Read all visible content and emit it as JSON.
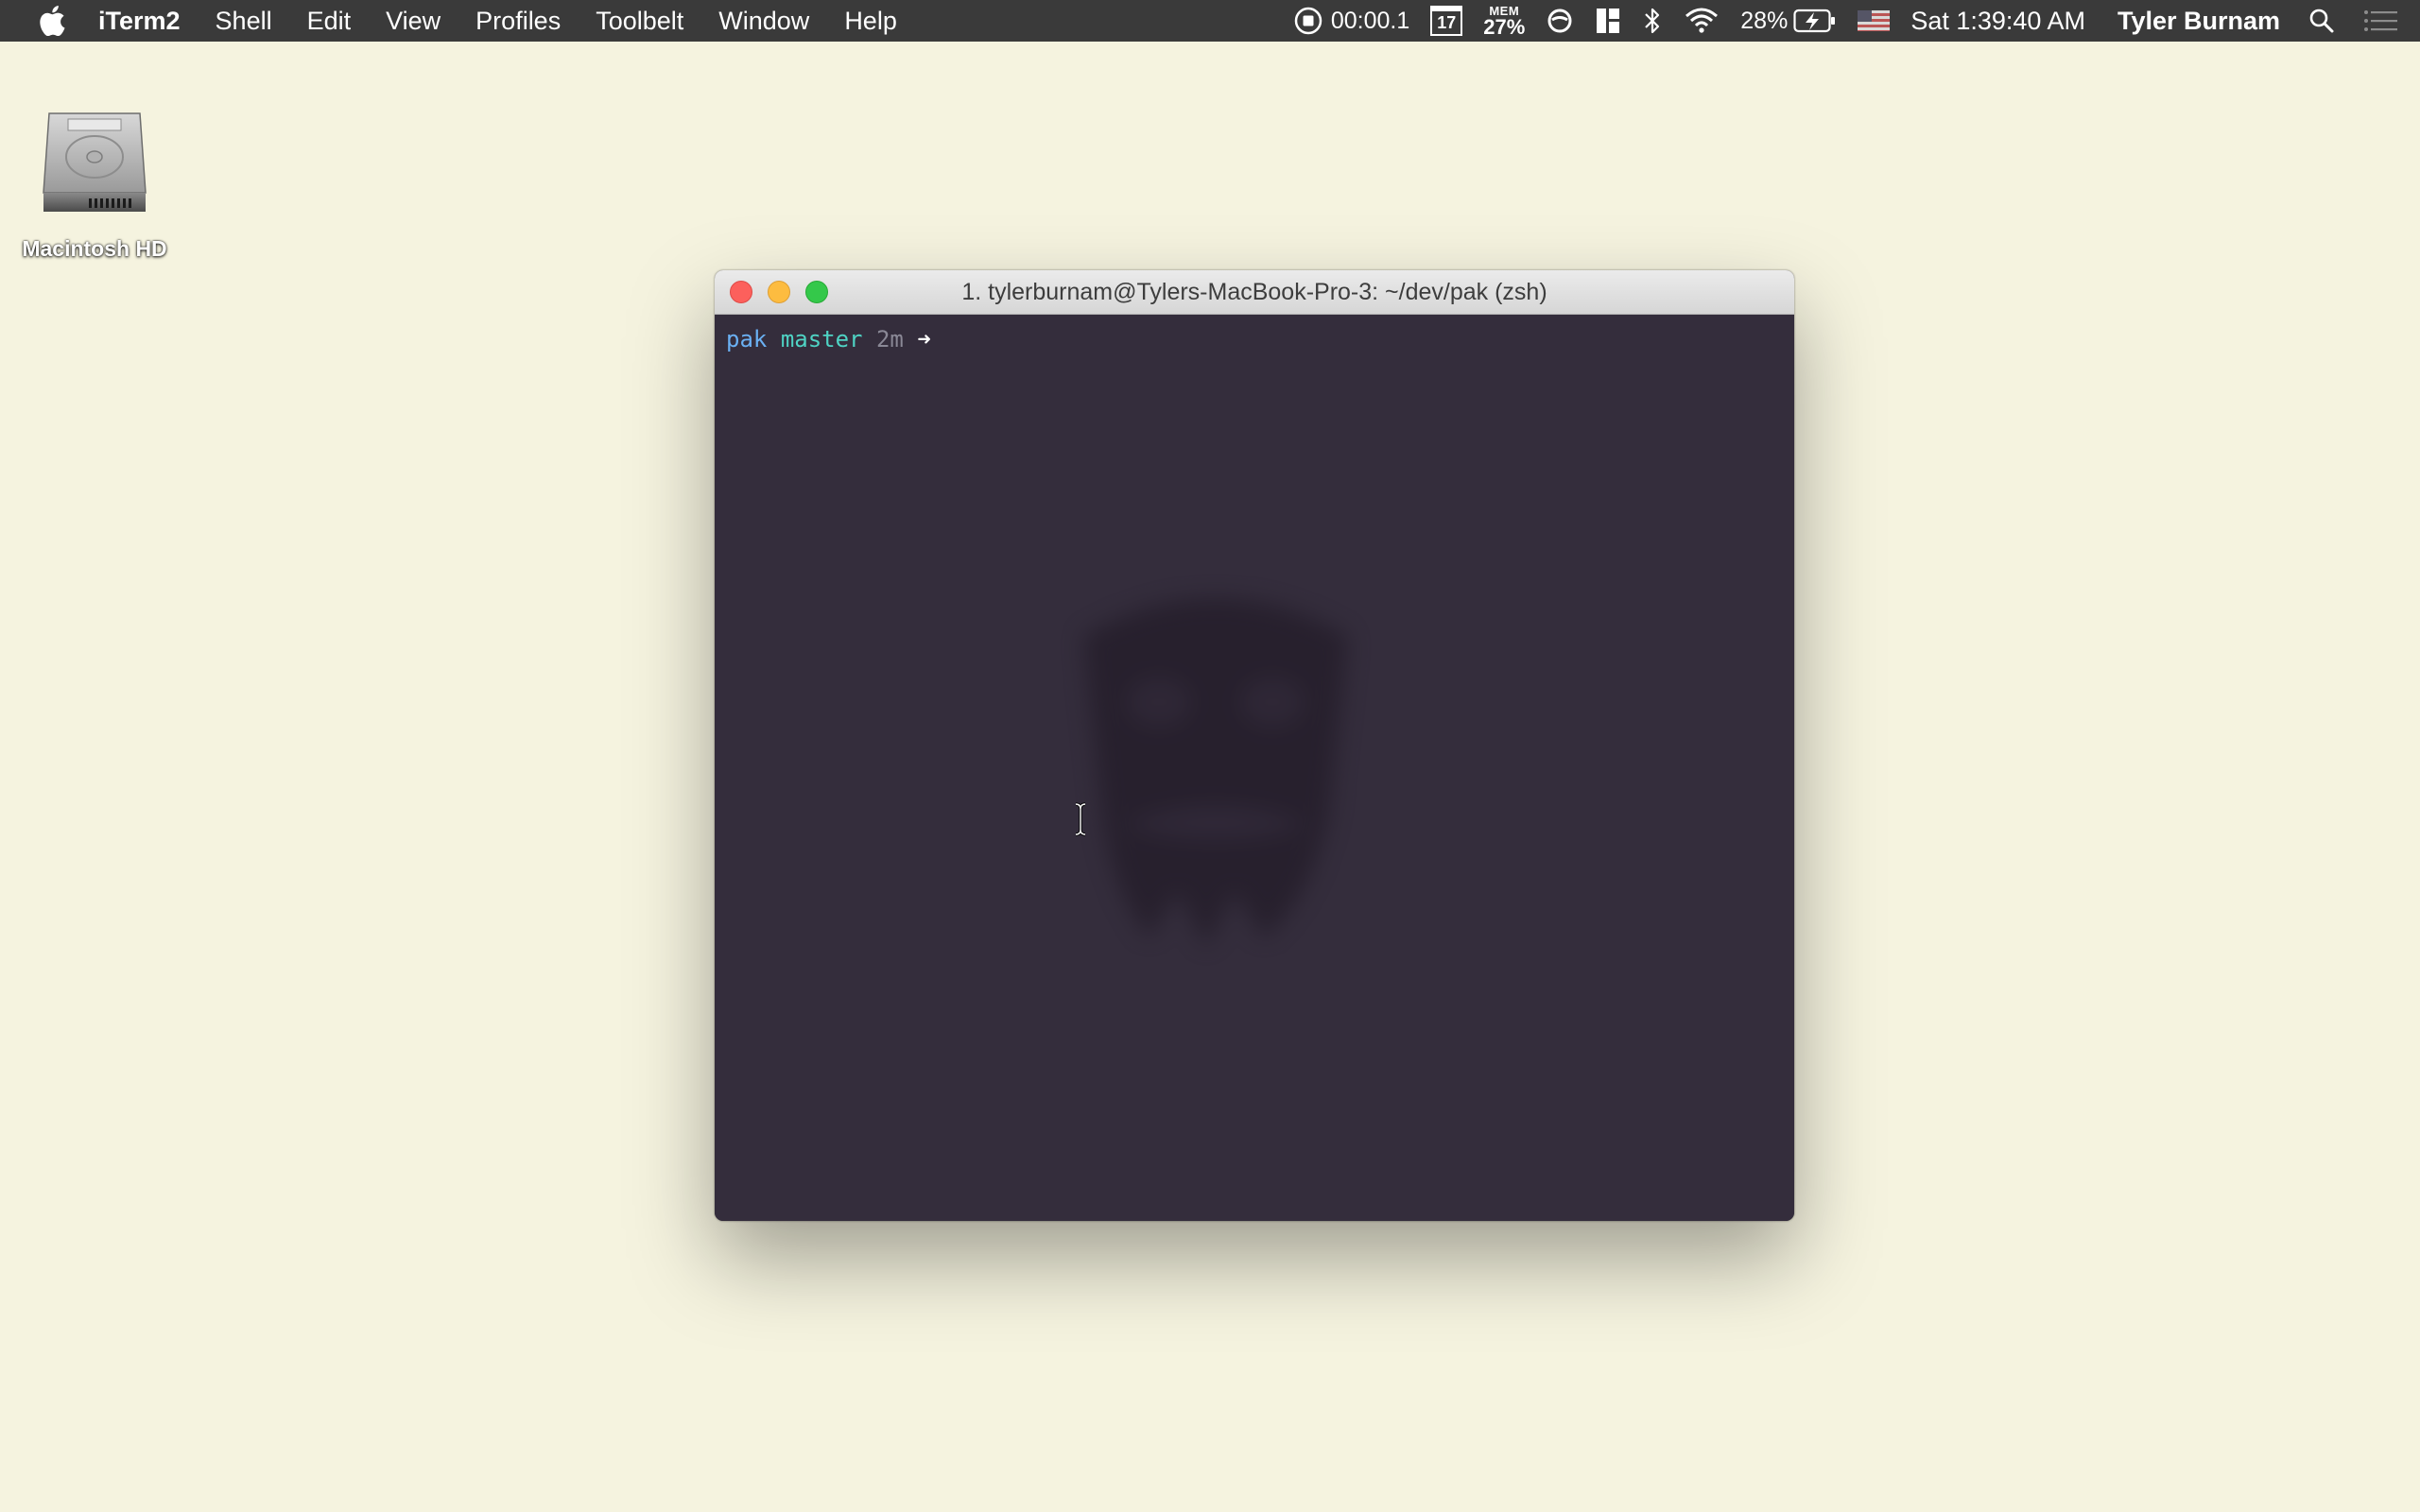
{
  "menubar": {
    "app_name": "iTerm2",
    "menus": [
      "Shell",
      "Edit",
      "View",
      "Profiles",
      "Toolbelt",
      "Window",
      "Help"
    ],
    "status": {
      "recording_timer": "00:00.1",
      "calendar_day": "17",
      "mem_label": "MEM",
      "mem_value": "27%",
      "battery_percent": "28%",
      "clock": "Sat 1:39:40 AM",
      "user_name": "Tyler Burnam"
    }
  },
  "desktop": {
    "icon_label": "Macintosh HD"
  },
  "window": {
    "title": "1. tylerburnam@Tylers-MacBook-Pro-3: ~/dev/pak (zsh)",
    "prompt": {
      "dir": "pak",
      "branch": "master",
      "elapsed": "2m",
      "arrow": "➜"
    }
  },
  "colors": {
    "desktop_bg": "#f5f3df",
    "menubar_bg": "#3a3a3a",
    "terminal_bg": "#342d3c",
    "prompt_dir": "#6ab0f3",
    "prompt_branch": "#4fd3c4",
    "prompt_time": "#8a8896"
  }
}
